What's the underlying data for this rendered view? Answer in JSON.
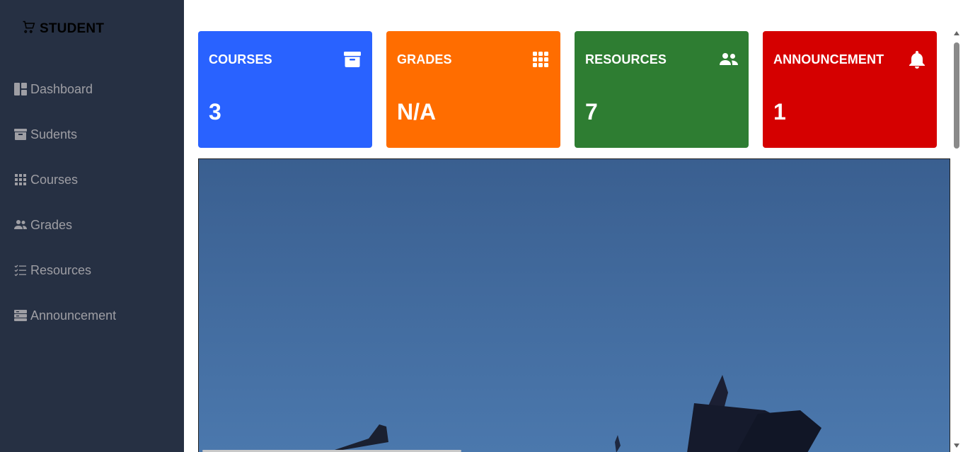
{
  "brand": {
    "label": "STUDENT",
    "icon": "cart-icon"
  },
  "sidebar": {
    "items": [
      {
        "label": "Dashboard",
        "icon": "dashboard-icon"
      },
      {
        "label": "Sudents",
        "icon": "archive-icon"
      },
      {
        "label": "Courses",
        "icon": "grid-icon"
      },
      {
        "label": "Grades",
        "icon": "people-icon"
      },
      {
        "label": "Resources",
        "icon": "list-check-icon"
      },
      {
        "label": "Announcement",
        "icon": "inventory-icon"
      }
    ]
  },
  "cards": [
    {
      "title": "COURSES",
      "value": "3",
      "icon": "archive-icon",
      "color": "#2962ff"
    },
    {
      "title": "GRADES",
      "value": "N/A",
      "icon": "grid-icon",
      "color": "#ff6d00"
    },
    {
      "title": "RESOURCES",
      "value": "7",
      "icon": "people-icon",
      "color": "#2e7d32"
    },
    {
      "title": "ANNOUNCEMENT",
      "value": "1",
      "icon": "bell-icon",
      "color": "#d50000"
    }
  ],
  "colors": {
    "sidebar_bg": "#263043",
    "sidebar_text": "#9e9ea4",
    "hero_sky": "#3f6799"
  }
}
